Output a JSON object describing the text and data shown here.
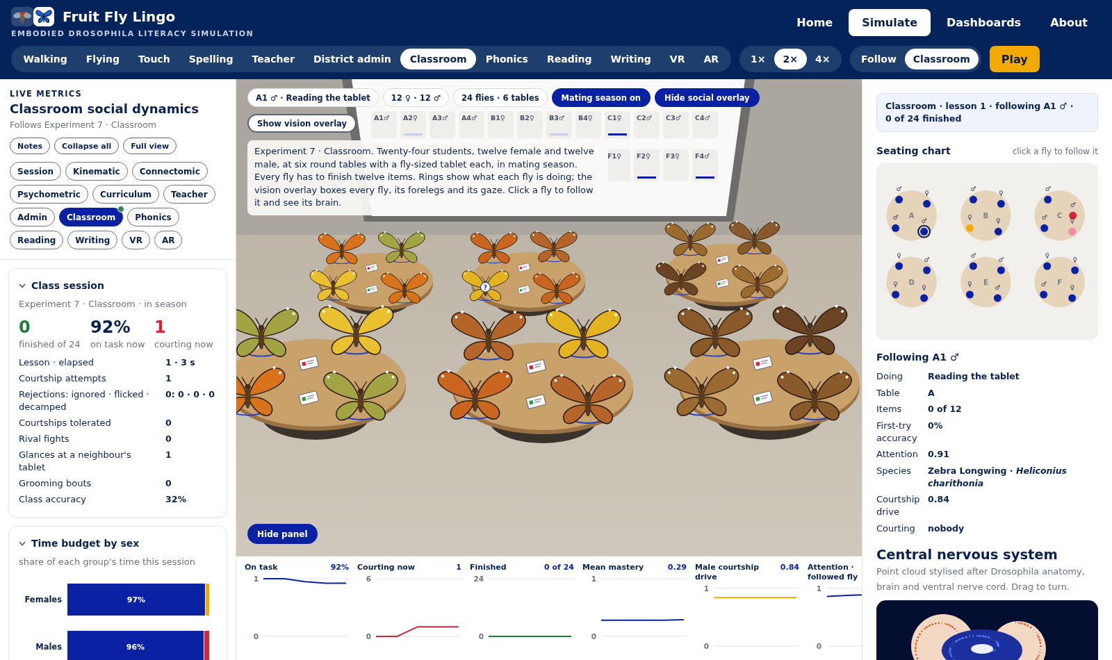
{
  "header": {
    "title": "Fruit Fly Lingo",
    "subtitle": "EMBODIED DROSOPHILA LITERACY SIMULATION",
    "nav": [
      {
        "label": "Home",
        "selected": false
      },
      {
        "label": "Simulate",
        "selected": true
      },
      {
        "label": "Dashboards",
        "selected": false
      },
      {
        "label": "About",
        "selected": false
      }
    ]
  },
  "mode_tabs": [
    {
      "label": "Walking",
      "selected": false
    },
    {
      "label": "Flying",
      "selected": false
    },
    {
      "label": "Touch",
      "selected": false
    },
    {
      "label": "Spelling",
      "selected": false
    },
    {
      "label": "Teacher",
      "selected": false
    },
    {
      "label": "District admin",
      "selected": false
    },
    {
      "label": "Classroom",
      "selected": true
    },
    {
      "label": "Phonics",
      "selected": false
    },
    {
      "label": "Reading",
      "selected": false
    },
    {
      "label": "Writing",
      "selected": false
    },
    {
      "label": "VR",
      "selected": false
    },
    {
      "label": "AR",
      "selected": false
    }
  ],
  "speed_options": [
    {
      "label": "1×",
      "selected": false
    },
    {
      "label": "2×",
      "selected": true
    },
    {
      "label": "4×",
      "selected": false
    }
  ],
  "view_options": [
    {
      "label": "Follow",
      "selected": false
    },
    {
      "label": "Classroom",
      "selected": true
    }
  ],
  "play_button": "Play",
  "metrics": {
    "eyebrow": "LIVE METRICS",
    "title": "Classroom social dynamics",
    "subtitle": "Follows Experiment 7 · Classroom",
    "actions": [
      "Notes",
      "Collapse all",
      "Full view"
    ],
    "tags": [
      {
        "label": "Session",
        "selected": false,
        "live": false
      },
      {
        "label": "Kinematic",
        "selected": false,
        "live": false
      },
      {
        "label": "Connectomic",
        "selected": false,
        "live": false
      },
      {
        "label": "Psychometric",
        "selected": false,
        "live": false
      },
      {
        "label": "Curriculum",
        "selected": false,
        "live": false
      },
      {
        "label": "Teacher",
        "selected": false,
        "live": false
      },
      {
        "label": "Admin",
        "selected": false,
        "live": false
      },
      {
        "label": "Classroom",
        "selected": true,
        "live": true
      },
      {
        "label": "Phonics",
        "selected": false,
        "live": false
      },
      {
        "label": "Reading",
        "selected": false,
        "live": false
      },
      {
        "label": "Writing",
        "selected": false,
        "live": false
      },
      {
        "label": "VR",
        "selected": false,
        "live": false
      },
      {
        "label": "AR",
        "selected": false,
        "live": false
      }
    ]
  },
  "class_session": {
    "title": "Class session",
    "expanded": true,
    "subtitle": "Experiment 7 · Classroom · in season",
    "stats": [
      {
        "value": "0",
        "label": "finished of 24",
        "color": "#1e7d3a"
      },
      {
        "value": "92%",
        "label": "on task now",
        "color": "#0a2150"
      },
      {
        "value": "1",
        "label": "courting now",
        "color": "#d3263a"
      }
    ],
    "rows": [
      {
        "label": "Lesson · elapsed",
        "value": "1 · 3 s"
      },
      {
        "label": "Courtship attempts",
        "value": "1"
      },
      {
        "label": "Rejections: ignored · flicked · decamped",
        "value": "0: 0 · 0 · 0"
      },
      {
        "label": "Courtships tolerated",
        "value": "0"
      },
      {
        "label": "Rival fights",
        "value": "0"
      },
      {
        "label": "Glances at a neighbour's tablet",
        "value": "1"
      },
      {
        "label": "Grooming bouts",
        "value": "0"
      },
      {
        "label": "Class accuracy",
        "value": "32%"
      }
    ]
  },
  "time_budget": {
    "title": "Time budget by sex",
    "expanded": true,
    "subtitle": "share of each group's time this session",
    "rows": [
      {
        "label": "Females",
        "value": "97%",
        "segments": [
          {
            "level": 0.97,
            "color": "#0b21a3"
          },
          {
            "level": 0.03,
            "color": "#f2a900"
          }
        ]
      },
      {
        "label": "Males",
        "value": "96%",
        "segments": [
          {
            "level": 0.96,
            "color": "#0b21a3"
          },
          {
            "level": 0.04,
            "color": "#d3263a"
          }
        ]
      }
    ]
  },
  "scene": {
    "chips": [
      "A1 ♂ · Reading the tablet",
      "12 ♀ · 12 ♂",
      "24 flies · 6 tables"
    ],
    "toggles": [
      {
        "label": "Mating season on",
        "on": true
      },
      {
        "label": "Hide social overlay",
        "on": true
      },
      {
        "label": "Show vision overlay",
        "on": false
      }
    ],
    "board_cards": [
      {
        "label": "A1♂",
        "kind": "plain"
      },
      {
        "label": "A2♀",
        "kind": "faint"
      },
      {
        "label": "A3♂",
        "kind": "plain"
      },
      {
        "label": "A4♂",
        "kind": "plain"
      },
      {
        "label": "B1♀",
        "kind": "plain"
      },
      {
        "label": "B2♀",
        "kind": "plain"
      },
      {
        "label": "B3♂",
        "kind": "faint"
      },
      {
        "label": "B4♀",
        "kind": "plain"
      },
      {
        "label": "C1♀",
        "kind": "marked"
      },
      {
        "label": "C2♂",
        "kind": "plain"
      },
      {
        "label": "C3♂",
        "kind": "plain"
      },
      {
        "label": "C4♂",
        "kind": "plain"
      }
    ],
    "board_cards_row_2": [
      {
        "label": "F1♀",
        "kind": "plain"
      },
      {
        "label": "F2♀",
        "kind": "marked"
      },
      {
        "label": "F3♀",
        "kind": "plain"
      },
      {
        "label": "F4♂",
        "kind": "marked"
      }
    ],
    "fly_marker": "?",
    "description": "Experiment 7 · Classroom. Twenty-four students, twelve female and twelve male, at six round tables with a fly-sized tablet each, in mating season. Every fly has to finish twelve items. Rings show what each fly is doing; the vision overlay boxes every fly, its forelegs and its gaze. Click a fly to follow it and see its brain.",
    "hide_panel_button": "Hide panel"
  },
  "trend_charts": [
    {
      "value": "92%",
      "color": "#0b21a3",
      "chart_data": {
        "type": "line",
        "title": "On task",
        "values": [
          1,
          1,
          0.95,
          0.92,
          0.92
        ],
        "ylim": [
          0,
          1
        ],
        "yticks": [
          0,
          1
        ]
      }
    },
    {
      "value": "1",
      "color": "#d3263a",
      "chart_data": {
        "type": "line",
        "title": "Courting now",
        "values": [
          0,
          0,
          1,
          1,
          1
        ],
        "ylim": [
          0,
          6
        ],
        "yticks": [
          0,
          6
        ]
      }
    },
    {
      "value": "0 of 24",
      "color": "#1e7d3a",
      "chart_data": {
        "type": "line",
        "title": "Finished",
        "values": [
          0,
          0,
          0,
          0,
          0
        ],
        "ylim": [
          0,
          24
        ],
        "yticks": [
          0,
          24
        ]
      }
    },
    {
      "value": "0.29",
      "color": "#0b21a3",
      "chart_data": {
        "type": "line",
        "title": "Mean mastery",
        "values": [
          0.28,
          0.28,
          0.28,
          0.28,
          0.29
        ],
        "ylim": [
          0,
          1
        ],
        "yticks": [
          0,
          1
        ]
      }
    },
    {
      "value": "0.84",
      "color": "#f2a900",
      "chart_data": {
        "type": "line",
        "title": "Male courtship drive",
        "values": [
          0.84,
          0.84,
          0.84,
          0.84,
          0.84
        ],
        "ylim": [
          0,
          1
        ],
        "yticks": [
          0,
          1
        ]
      }
    },
    {
      "title": "Attention · followed fly",
      "axis_labels": [
        "1",
        "0"
      ]
    }
  ],
  "following_status": "Classroom · lesson 1 · following A1 ♂ · 0 of 24 finished",
  "seating_chart": {
    "title": "Seating chart",
    "hint": "click a fly to follow it",
    "tables": [
      {
        "label": "A",
        "seats": [
          {
            "sex": "♂",
            "color": "#0b21a3",
            "selected": false
          },
          {
            "sex": "♀",
            "color": "#0b21a3",
            "selected": false
          },
          {
            "sex": "♂",
            "color": "#0b21a3",
            "selected": false
          },
          {
            "sex": "♂",
            "color": "#0b21a3",
            "selected": true
          }
        ]
      },
      {
        "label": "B",
        "seats": [
          {
            "sex": "♂",
            "color": "#0b21a3",
            "selected": false
          },
          {
            "sex": "♀",
            "color": "#0b21a3",
            "selected": false
          },
          {
            "sex": "♀",
            "color": "#f2a900",
            "selected": false
          },
          {
            "sex": "♀",
            "color": "#0b21a3",
            "selected": false
          }
        ]
      },
      {
        "label": "C",
        "seats": [
          {
            "sex": "♂",
            "color": "#0b21a3",
            "selected": false
          },
          {
            "sex": "♂",
            "color": "#d3263a",
            "selected": false
          },
          {
            "sex": "♂",
            "color": "#0b21a3",
            "selected": false
          },
          {
            "sex": "♀",
            "color": "#ee8ea5",
            "selected": false
          }
        ]
      },
      {
        "label": "D",
        "seats": [
          {
            "sex": "♀",
            "color": "#0b21a3",
            "selected": false
          },
          {
            "sex": "♂",
            "color": "#0b21a3",
            "selected": false
          },
          {
            "sex": "♀",
            "color": "#0b21a3",
            "selected": false
          },
          {
            "sex": "♀",
            "color": "#0b21a3",
            "selected": false
          }
        ]
      },
      {
        "label": "E",
        "seats": [
          {
            "sex": "♂",
            "color": "#0b21a3",
            "selected": false
          },
          {
            "sex": "♂",
            "color": "#0b21a3",
            "selected": false
          },
          {
            "sex": "♀",
            "color": "#0b21a3",
            "selected": false
          },
          {
            "sex": "♂",
            "color": "#0b21a3",
            "selected": false
          }
        ]
      },
      {
        "label": "F",
        "seats": [
          {
            "sex": "♀",
            "color": "#0b21a3",
            "selected": false
          },
          {
            "sex": "♀",
            "color": "#0b21a3",
            "selected": false
          },
          {
            "sex": "♂",
            "color": "#0b21a3",
            "selected": false
          },
          {
            "sex": "♀",
            "color": "#0b21a3",
            "selected": false
          }
        ]
      }
    ]
  },
  "following": {
    "title": "Following A1 ♂",
    "rows": [
      {
        "label": "Doing",
        "value": "Reading the tablet"
      },
      {
        "label": "Table",
        "value": "A"
      },
      {
        "label": "Items",
        "value": "0 of 12"
      },
      {
        "label": "First-try accuracy",
        "value": "0%"
      },
      {
        "label": "Attention",
        "value": "0.91"
      },
      {
        "label": "Species",
        "value": "Zebra Longwing · *Heliconius charithonia*"
      },
      {
        "label": "Courtship drive",
        "value": "0.84"
      },
      {
        "label": "Courting",
        "value": "nobody"
      }
    ]
  },
  "nervous_system": {
    "title": "Central nervous system",
    "description": "Point cloud stylised after Drosophila anatomy, brain and ventral nerve cord. Drag to turn."
  }
}
